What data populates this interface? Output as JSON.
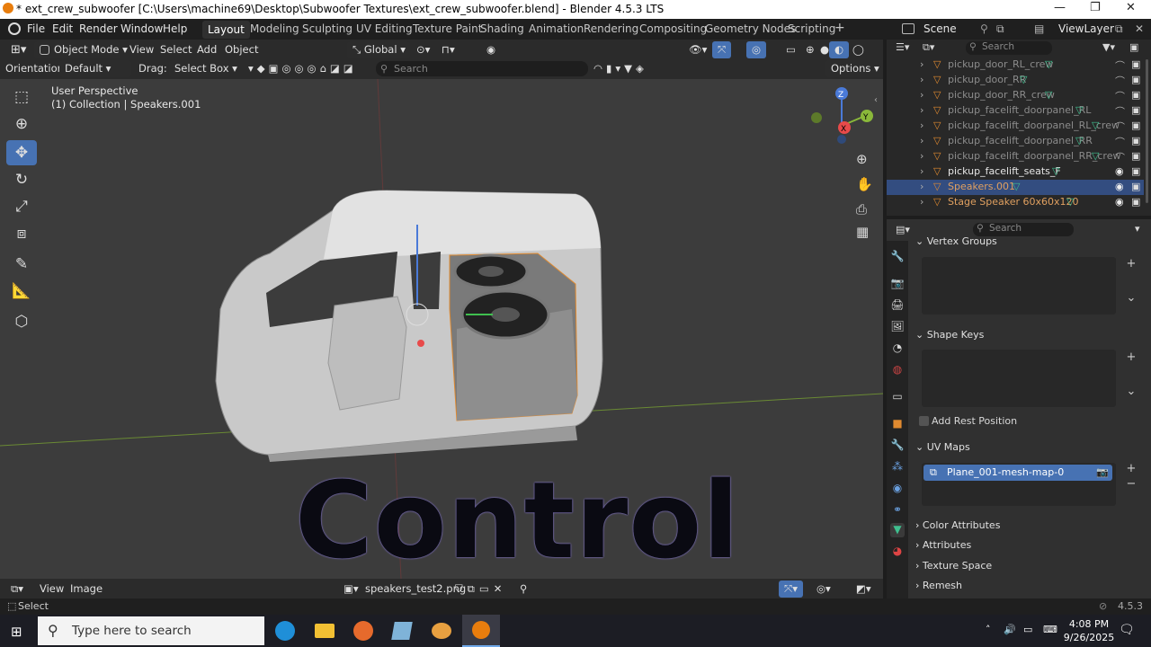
{
  "window": {
    "title": "* ext_crew_subwoofer [C:\\Users\\machine69\\Desktop\\Subwoofer Textures\\ext_crew_subwoofer.blend] - Blender 4.5.3 LTS",
    "minimize": "—",
    "restore": "❐",
    "close": "✕"
  },
  "menu": [
    "File",
    "Edit",
    "Render",
    "Window",
    "Help"
  ],
  "workspaces": [
    "Layout",
    "Modeling",
    "Sculpting",
    "UV Editing",
    "Texture Paint",
    "Shading",
    "Animation",
    "Rendering",
    "Compositing",
    "Geometry Nodes",
    "Scripting"
  ],
  "add_workspace": "+",
  "scene": {
    "label": "Scene",
    "viewlayer": "ViewLayer"
  },
  "viewport_header": {
    "mode": "Object Mode",
    "menus": [
      "View",
      "Select",
      "Add",
      "Object"
    ],
    "transform": "Global"
  },
  "tool_settings": {
    "orientation_label": "Orientation:",
    "orientation_value": "Default",
    "drag_label": "Drag:",
    "drag_value": "Select Box",
    "search_placeholder": "Search",
    "options": "Options"
  },
  "overlay_text": {
    "perspective": "User Perspective",
    "collection": "(1) Collection | Speakers.001"
  },
  "big_caption": "Control",
  "gizmo": {
    "x": "X",
    "y": "Y",
    "z": "Z"
  },
  "outliner": {
    "search_placeholder": "Search",
    "items": [
      {
        "label": "pickup_door_RL_crew",
        "dim": true
      },
      {
        "label": "pickup_door_RR",
        "dim": true
      },
      {
        "label": "pickup_door_RR_crew",
        "dim": true
      },
      {
        "label": "pickup_facelift_doorpanel_RL",
        "dim": true
      },
      {
        "label": "pickup_facelift_doorpanel_RL_crew",
        "dim": true
      },
      {
        "label": "pickup_facelift_doorpanel_RR",
        "dim": true
      },
      {
        "label": "pickup_facelift_doorpanel_RR_crew",
        "dim": true
      },
      {
        "label": "pickup_facelift_seats_F",
        "dim": false
      },
      {
        "label": "Speakers.001",
        "dim": false,
        "selected": true
      },
      {
        "label": "Stage Speaker 60x60x120",
        "dim": false
      }
    ]
  },
  "properties": {
    "search_placeholder": "Search",
    "panels": {
      "vertex_groups": "Vertex Groups",
      "shape_keys": "Shape Keys",
      "add_rest_position": "Add Rest Position",
      "uv_maps": "UV Maps",
      "uv_map_item": "Plane_001-mesh-map-0",
      "color_attributes": "Color Attributes",
      "attributes": "Attributes",
      "texture_space": "Texture Space",
      "remesh": "Remesh"
    }
  },
  "image_editor": {
    "view": "View",
    "image": "Image",
    "filename": "speakers_test2.png"
  },
  "status": {
    "select": "Select",
    "version": "4.5.3"
  },
  "taskbar": {
    "search_placeholder": "Type here to search",
    "time": "4:08 PM",
    "date": "9/26/2025"
  },
  "colors": {
    "accent": "#4772b3",
    "selected_row": "#334d80",
    "object_orange": "#e0a060"
  }
}
